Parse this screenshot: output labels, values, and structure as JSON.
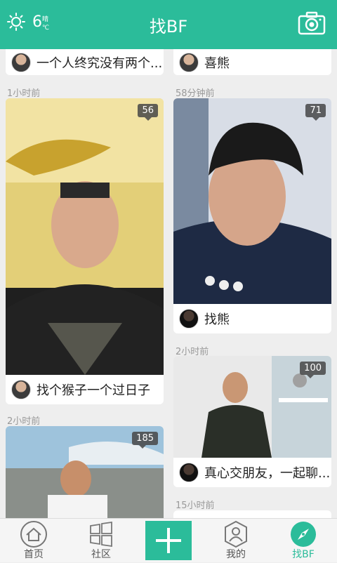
{
  "header": {
    "temperature": "6",
    "condition": "晴",
    "unit": "℃",
    "title": "找BF"
  },
  "cards": [
    {
      "time": "",
      "caption": "一个人终究没有两个..."
    },
    {
      "time": "",
      "caption": "喜熊"
    },
    {
      "time": "1小时前",
      "caption": "找个猴子一个过日子",
      "count": "56"
    },
    {
      "time": "58分钟前",
      "caption": "找熊",
      "count": "71"
    },
    {
      "time": "2小时前",
      "caption": "真心交朋友，一起聊...",
      "count": "100"
    },
    {
      "time": "2小时前",
      "caption": "",
      "count": "185"
    },
    {
      "time": "15小时前",
      "caption": ""
    }
  ],
  "nav": {
    "home": "首页",
    "community": "社区",
    "mine": "我的",
    "find": "找BF"
  },
  "colors": {
    "accent": "#2bbc9a"
  }
}
